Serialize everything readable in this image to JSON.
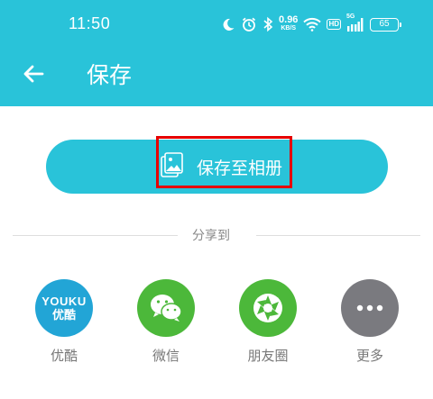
{
  "status_bar": {
    "time": "11:50",
    "net_speed": "0.96",
    "net_speed_unit": "KB/S",
    "hd_label": "HD",
    "signal_label": "5G",
    "battery": "65"
  },
  "header": {
    "title": "保存"
  },
  "save_button": {
    "label": "保存至相册"
  },
  "share": {
    "label": "分享到",
    "apps": [
      {
        "name": "优酷",
        "logo_top": "YOUKU",
        "logo_bottom": "优酷",
        "color": "#22a5d6"
      },
      {
        "name": "微信",
        "color": "#4cb83a"
      },
      {
        "name": "朋友圈",
        "color": "#4cb83a"
      },
      {
        "name": "更多",
        "color": "#7a7a7f"
      }
    ]
  },
  "colors": {
    "accent": "#29c3d9",
    "highlight": "#e60000"
  },
  "icons": [
    "moon-icon",
    "alarm-icon",
    "bluetooth-icon",
    "wifi-icon",
    "signal-icon",
    "battery-icon",
    "back-arrow-icon",
    "album-image-icon",
    "wechat-icon",
    "moments-icon",
    "more-dots-icon"
  ]
}
